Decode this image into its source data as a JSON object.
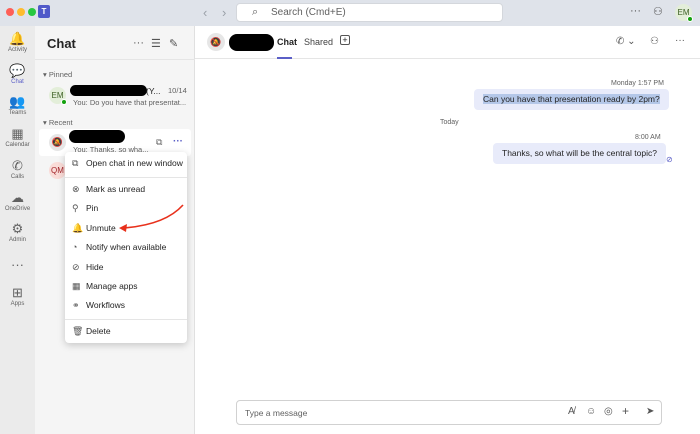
{
  "topbar": {
    "search_placeholder": "Search (Cmd+E)",
    "back": "‹",
    "forward": "›",
    "more": "···",
    "user_initials": "EM",
    "app_logo": "T"
  },
  "rail": [
    {
      "label": "Activity",
      "icon": "🔔"
    },
    {
      "label": "Chat",
      "icon": "💬"
    },
    {
      "label": "Teams",
      "icon": "👥"
    },
    {
      "label": "Calendar",
      "icon": "▦"
    },
    {
      "label": "Calls",
      "icon": "✆"
    },
    {
      "label": "OneDrive",
      "icon": "☁"
    },
    {
      "label": "Admin",
      "icon": "⚙"
    },
    {
      "label": "",
      "icon": "···"
    },
    {
      "label": "Apps",
      "icon": "⊞"
    }
  ],
  "chatlist": {
    "title": "Chat",
    "more": "···",
    "filter": "☰",
    "compose": "✎",
    "pinned_label": "Pinned",
    "recent_label": "Recent",
    "pinned": [
      {
        "initials": "EM",
        "name_tail": "(Y...",
        "date": "10/14",
        "preview": "You: Do you have that presentat..."
      }
    ],
    "recent": [
      {
        "preview": "You: Thanks, so wha...",
        "more": "···"
      },
      {
        "initials": "QM"
      }
    ]
  },
  "menu": {
    "items": [
      "Open chat in new window",
      "Mark as unread",
      "Pin",
      "Unmute",
      "Notify when available",
      "Hide",
      "Manage apps",
      "Workflows",
      "Delete"
    ]
  },
  "main": {
    "tabs": [
      "Chat",
      "Shared"
    ],
    "add_tab": "+",
    "messages": [
      {
        "time": "Monday 1:57 PM",
        "text": "Can you have that presentation ready by 2pm?"
      },
      {
        "divider": "Today"
      },
      {
        "time": "8:00 AM",
        "text": "Thanks, so what will be the central topic?"
      }
    ],
    "compose_placeholder": "Type a message"
  },
  "colors": {
    "accent": "#5b5fc7",
    "arrow": "#e8311c"
  }
}
